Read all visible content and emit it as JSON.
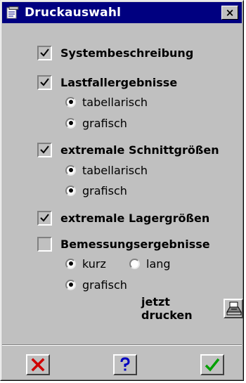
{
  "window": {
    "title": "Druckauswahl",
    "close_glyph": "×"
  },
  "options": {
    "systembeschreibung": {
      "label": "Systembeschreibung",
      "checked": true
    },
    "lastfall": {
      "label": "Lastfallergebnisse",
      "checked": true,
      "sub": [
        {
          "label": "tabellarisch",
          "selected": true
        },
        {
          "label": "grafisch",
          "selected": true
        }
      ]
    },
    "schnitt": {
      "label": "extremale Schnittgrößen",
      "checked": true,
      "sub": [
        {
          "label": "tabellarisch",
          "selected": true
        },
        {
          "label": "grafisch",
          "selected": true
        }
      ]
    },
    "lager": {
      "label": "extremale Lagergrößen",
      "checked": true
    },
    "bemessung": {
      "label": "Bemessungsergebnisse",
      "checked": false,
      "kurz": {
        "label": "kurz",
        "selected": true
      },
      "lang": {
        "label": "lang",
        "selected": false
      },
      "grafisch": {
        "label": "grafisch",
        "selected": true
      }
    }
  },
  "print": {
    "label": "jetzt drucken",
    "icon": "printer-icon"
  },
  "buttons": {
    "cancel": {
      "icon": "cancel-x-icon",
      "color": "#d00000"
    },
    "help": {
      "icon": "help-question-icon",
      "color": "#0000c0"
    },
    "ok": {
      "icon": "ok-check-icon",
      "color": "#00a000"
    }
  },
  "colors": {
    "titlebar": "#000080",
    "face": "#c0c0c0"
  }
}
